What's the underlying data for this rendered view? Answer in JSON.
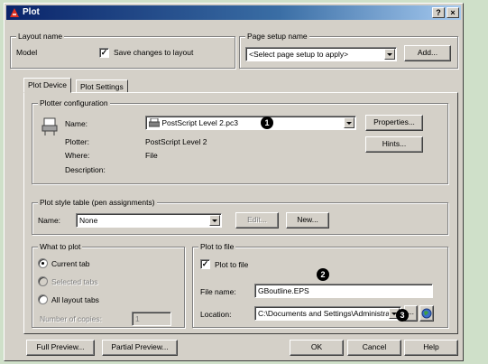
{
  "window": {
    "title": "Plot",
    "help_glyph": "?",
    "close_glyph": "×"
  },
  "layout_name": {
    "legend": "Layout name",
    "value": "Model",
    "save_label": "Save changes to layout",
    "save_checked": true
  },
  "page_setup": {
    "legend": "Page setup name",
    "value": "<Select page setup to apply>",
    "add_label": "Add..."
  },
  "tabs": [
    {
      "label": "Plot Device",
      "active": true
    },
    {
      "label": "Plot Settings",
      "active": false
    }
  ],
  "plotter_config": {
    "legend": "Plotter configuration",
    "name_label": "Name:",
    "name_value": "PostScript Level 2.pc3",
    "plotter_label": "Plotter:",
    "plotter_value": "PostScript Level 2",
    "where_label": "Where:",
    "where_value": "File",
    "description_label": "Description:",
    "properties_label": "Properties...",
    "hints_label": "Hints..."
  },
  "plot_style": {
    "legend": "Plot style table (pen assignments)",
    "name_label": "Name:",
    "name_value": "None",
    "edit_label": "Edit...",
    "new_label": "New..."
  },
  "what_to_plot": {
    "legend": "What to plot",
    "options": [
      {
        "label": "Current tab",
        "selected": true,
        "enabled": true
      },
      {
        "label": "Selected tabs",
        "selected": false,
        "enabled": false
      },
      {
        "label": "All layout tabs",
        "selected": false,
        "enabled": true
      }
    ],
    "copies_label": "Number of copies:",
    "copies_value": "1"
  },
  "plot_to_file": {
    "legend": "Plot to file",
    "checkbox_label": "Plot to file",
    "checked": true,
    "file_name_label": "File name:",
    "file_name_value": "GBoutline.EPS",
    "location_label": "Location:",
    "location_value": "C:\\Documents and Settings\\Administrat",
    "browse_label": "..."
  },
  "footer": {
    "full_preview": "Full Preview...",
    "partial_preview": "Partial Preview...",
    "ok": "OK",
    "cancel": "Cancel",
    "help": "Help"
  },
  "callouts": [
    "1",
    "2",
    "3"
  ],
  "colors": {
    "titlebar_start": "#0a246a",
    "titlebar_end": "#a6caf0",
    "dialog_face": "#d4d0c8",
    "background": "#cfe0c9"
  }
}
